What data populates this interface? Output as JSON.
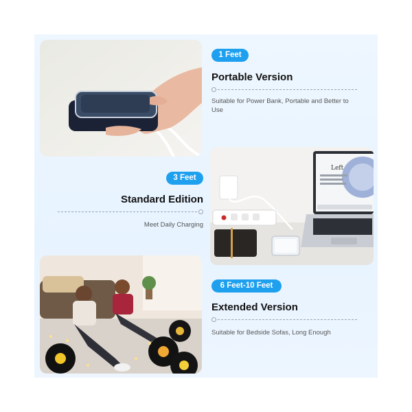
{
  "sections": [
    {
      "badge": "1 Feet",
      "title": "Portable Version",
      "description": "Suitable for Power Bank, Portable and Better to Use",
      "image": "hand-holding-power-bank-with-cable"
    },
    {
      "badge": "3 Feet",
      "title": "Standard Edition",
      "description": "Meet Daily Charging",
      "image": "laptop-and-phone-on-desk"
    },
    {
      "badge": "6 Feet-10 Feet",
      "title": "Extended Version",
      "description": "Suitable for Bedside Sofas, Long Enough",
      "image": "two-girls-with-phones-on-floor"
    }
  ],
  "laptop_screen_text": "Left",
  "colors": {
    "accent": "#1ea0ef",
    "background": "#e9f4ff",
    "title": "#111111",
    "description": "#555555"
  }
}
